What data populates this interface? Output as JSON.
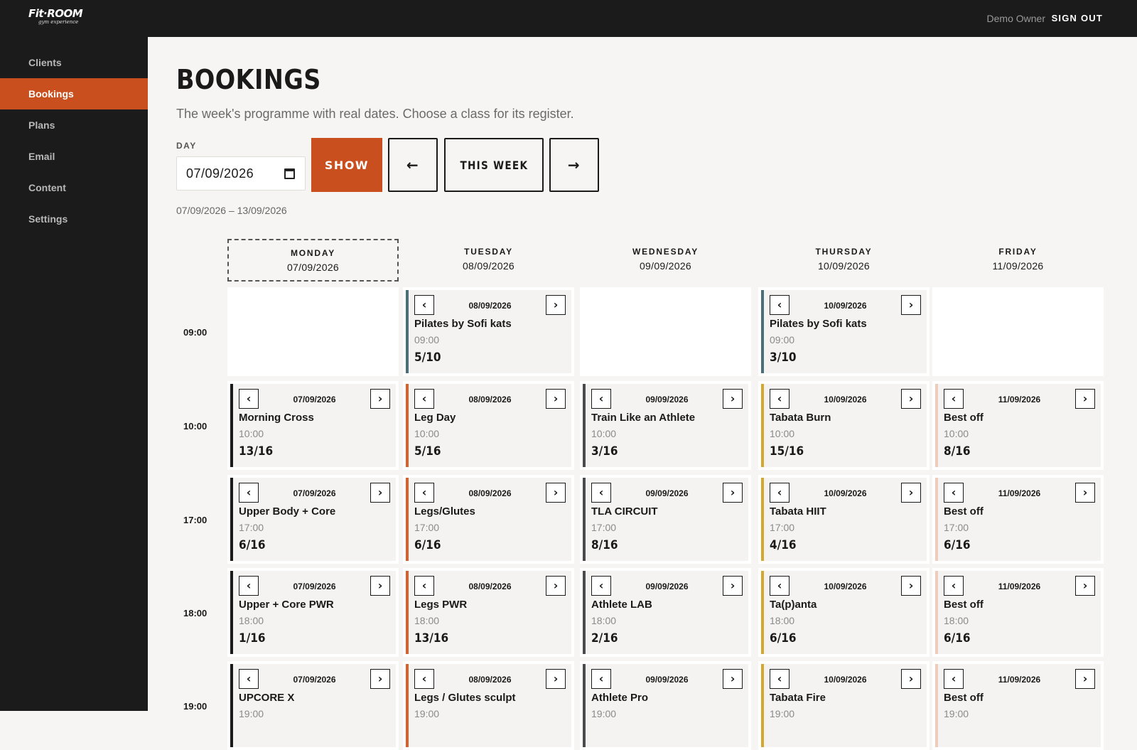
{
  "app": {
    "logo_main": "Fit·ROOM",
    "logo_sub": "gym experience"
  },
  "topbar": {
    "user": "Demo Owner",
    "signout": "SIGN OUT"
  },
  "sidebar": {
    "items": [
      {
        "label": "Clients",
        "active": false
      },
      {
        "label": "Bookings",
        "active": true
      },
      {
        "label": "Plans",
        "active": false
      },
      {
        "label": "Email",
        "active": false
      },
      {
        "label": "Content",
        "active": false
      },
      {
        "label": "Settings",
        "active": false
      }
    ]
  },
  "page": {
    "title": "BOOKINGS",
    "subtitle": "The week's programme with real dates. Choose a class for its register.",
    "day_label": "DAY",
    "day_value": "07/09/2026",
    "show_label": "SHOW",
    "prev_label": "←",
    "this_week_label": "THIS WEEK",
    "next_label": "→",
    "range": "07/09/2026 – 13/09/2026"
  },
  "schedule": {
    "days": [
      {
        "name": "MONDAY",
        "date": "07/09/2026",
        "today": true,
        "accent": "#1a1a1a"
      },
      {
        "name": "TUESDAY",
        "date": "08/09/2026",
        "today": false,
        "accent": "#d9602b"
      },
      {
        "name": "WEDNESDAY",
        "date": "09/09/2026",
        "today": false,
        "accent": "#4a4a4f"
      },
      {
        "name": "THURSDAY",
        "date": "10/09/2026",
        "today": false,
        "accent": "#d4a82e"
      },
      {
        "name": "FRIDAY",
        "date": "11/09/2026",
        "today": false,
        "accent": "#eccdbb"
      }
    ],
    "times": [
      "09:00",
      "10:00",
      "17:00",
      "18:00",
      "19:00"
    ],
    "rows": [
      [
        null,
        {
          "date": "08/09/2026",
          "name": "Pilates by Sofi kats",
          "time": "09:00",
          "count": "5/10",
          "accent": "#4a6f7a"
        },
        null,
        {
          "date": "10/09/2026",
          "name": "Pilates by Sofi kats",
          "time": "09:00",
          "count": "3/10",
          "accent": "#4a6f7a"
        },
        null
      ],
      [
        {
          "date": "07/09/2026",
          "name": "Morning Cross",
          "time": "10:00",
          "count": "13/16"
        },
        {
          "date": "08/09/2026",
          "name": "Leg Day",
          "time": "10:00",
          "count": "5/16"
        },
        {
          "date": "09/09/2026",
          "name": "Train Like an Athlete",
          "time": "10:00",
          "count": "3/16"
        },
        {
          "date": "10/09/2026",
          "name": "Tabata Burn",
          "time": "10:00",
          "count": "15/16"
        },
        {
          "date": "11/09/2026",
          "name": "Best off",
          "time": "10:00",
          "count": "8/16"
        }
      ],
      [
        {
          "date": "07/09/2026",
          "name": "Upper Body + Core",
          "time": "17:00",
          "count": "6/16"
        },
        {
          "date": "08/09/2026",
          "name": "Legs/Glutes",
          "time": "17:00",
          "count": "6/16"
        },
        {
          "date": "09/09/2026",
          "name": "TLA CIRCUIT",
          "time": "17:00",
          "count": "8/16"
        },
        {
          "date": "10/09/2026",
          "name": "Tabata HIIT",
          "time": "17:00",
          "count": "4/16"
        },
        {
          "date": "11/09/2026",
          "name": "Best off",
          "time": "17:00",
          "count": "6/16"
        }
      ],
      [
        {
          "date": "07/09/2026",
          "name": "Upper + Core PWR",
          "time": "18:00",
          "count": "1/16"
        },
        {
          "date": "08/09/2026",
          "name": "Legs PWR",
          "time": "18:00",
          "count": "13/16"
        },
        {
          "date": "09/09/2026",
          "name": "Athlete LAB",
          "time": "18:00",
          "count": "2/16"
        },
        {
          "date": "10/09/2026",
          "name": "Ta(p)anta",
          "time": "18:00",
          "count": "6/16"
        },
        {
          "date": "11/09/2026",
          "name": "Best off",
          "time": "18:00",
          "count": "6/16"
        }
      ],
      [
        {
          "date": "07/09/2026",
          "name": "UPCORE X",
          "time": "19:00",
          "count": ""
        },
        {
          "date": "08/09/2026",
          "name": "Legs / Glutes sculpt",
          "time": "19:00",
          "count": ""
        },
        {
          "date": "09/09/2026",
          "name": "Athlete Pro",
          "time": "19:00",
          "count": ""
        },
        {
          "date": "10/09/2026",
          "name": "Tabata Fire",
          "time": "19:00",
          "count": ""
        },
        {
          "date": "11/09/2026",
          "name": "Best off",
          "time": "19:00",
          "count": ""
        }
      ]
    ],
    "nav_prev_glyph": "‹",
    "nav_next_glyph": "›"
  }
}
